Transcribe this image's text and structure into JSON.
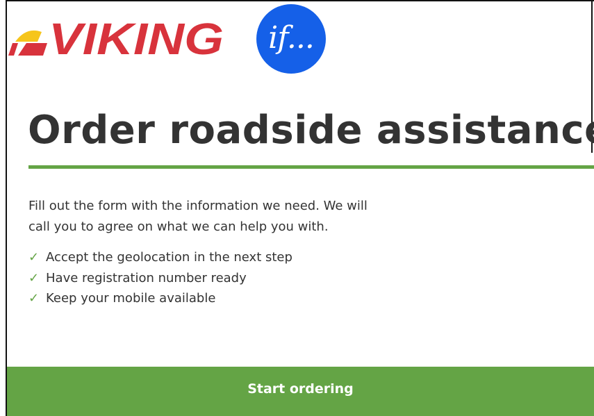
{
  "logos": {
    "viking": {
      "text": "VIKING",
      "colors": {
        "red": "#d8333c",
        "yellow": "#f6c51b"
      }
    },
    "if": {
      "text": "if...",
      "color": "#1560e8"
    }
  },
  "main": {
    "title": "Order roadside assistance",
    "intro": "Fill out the form with the information we need. We will call you to agree on what we can help you with.",
    "checklist": [
      {
        "icon": "check-icon",
        "mark": "✓",
        "text": "Accept the geolocation in the next step"
      },
      {
        "icon": "check-icon",
        "mark": "✓",
        "text": "Have registration number ready"
      },
      {
        "icon": "check-icon",
        "mark": "✓",
        "text": "Keep your mobile available"
      }
    ]
  },
  "actions": {
    "start_label": "Start ordering"
  },
  "colors": {
    "accent_green": "#64a445",
    "text": "#333333",
    "if_blue": "#1560e8",
    "viking_red": "#d8333c"
  }
}
